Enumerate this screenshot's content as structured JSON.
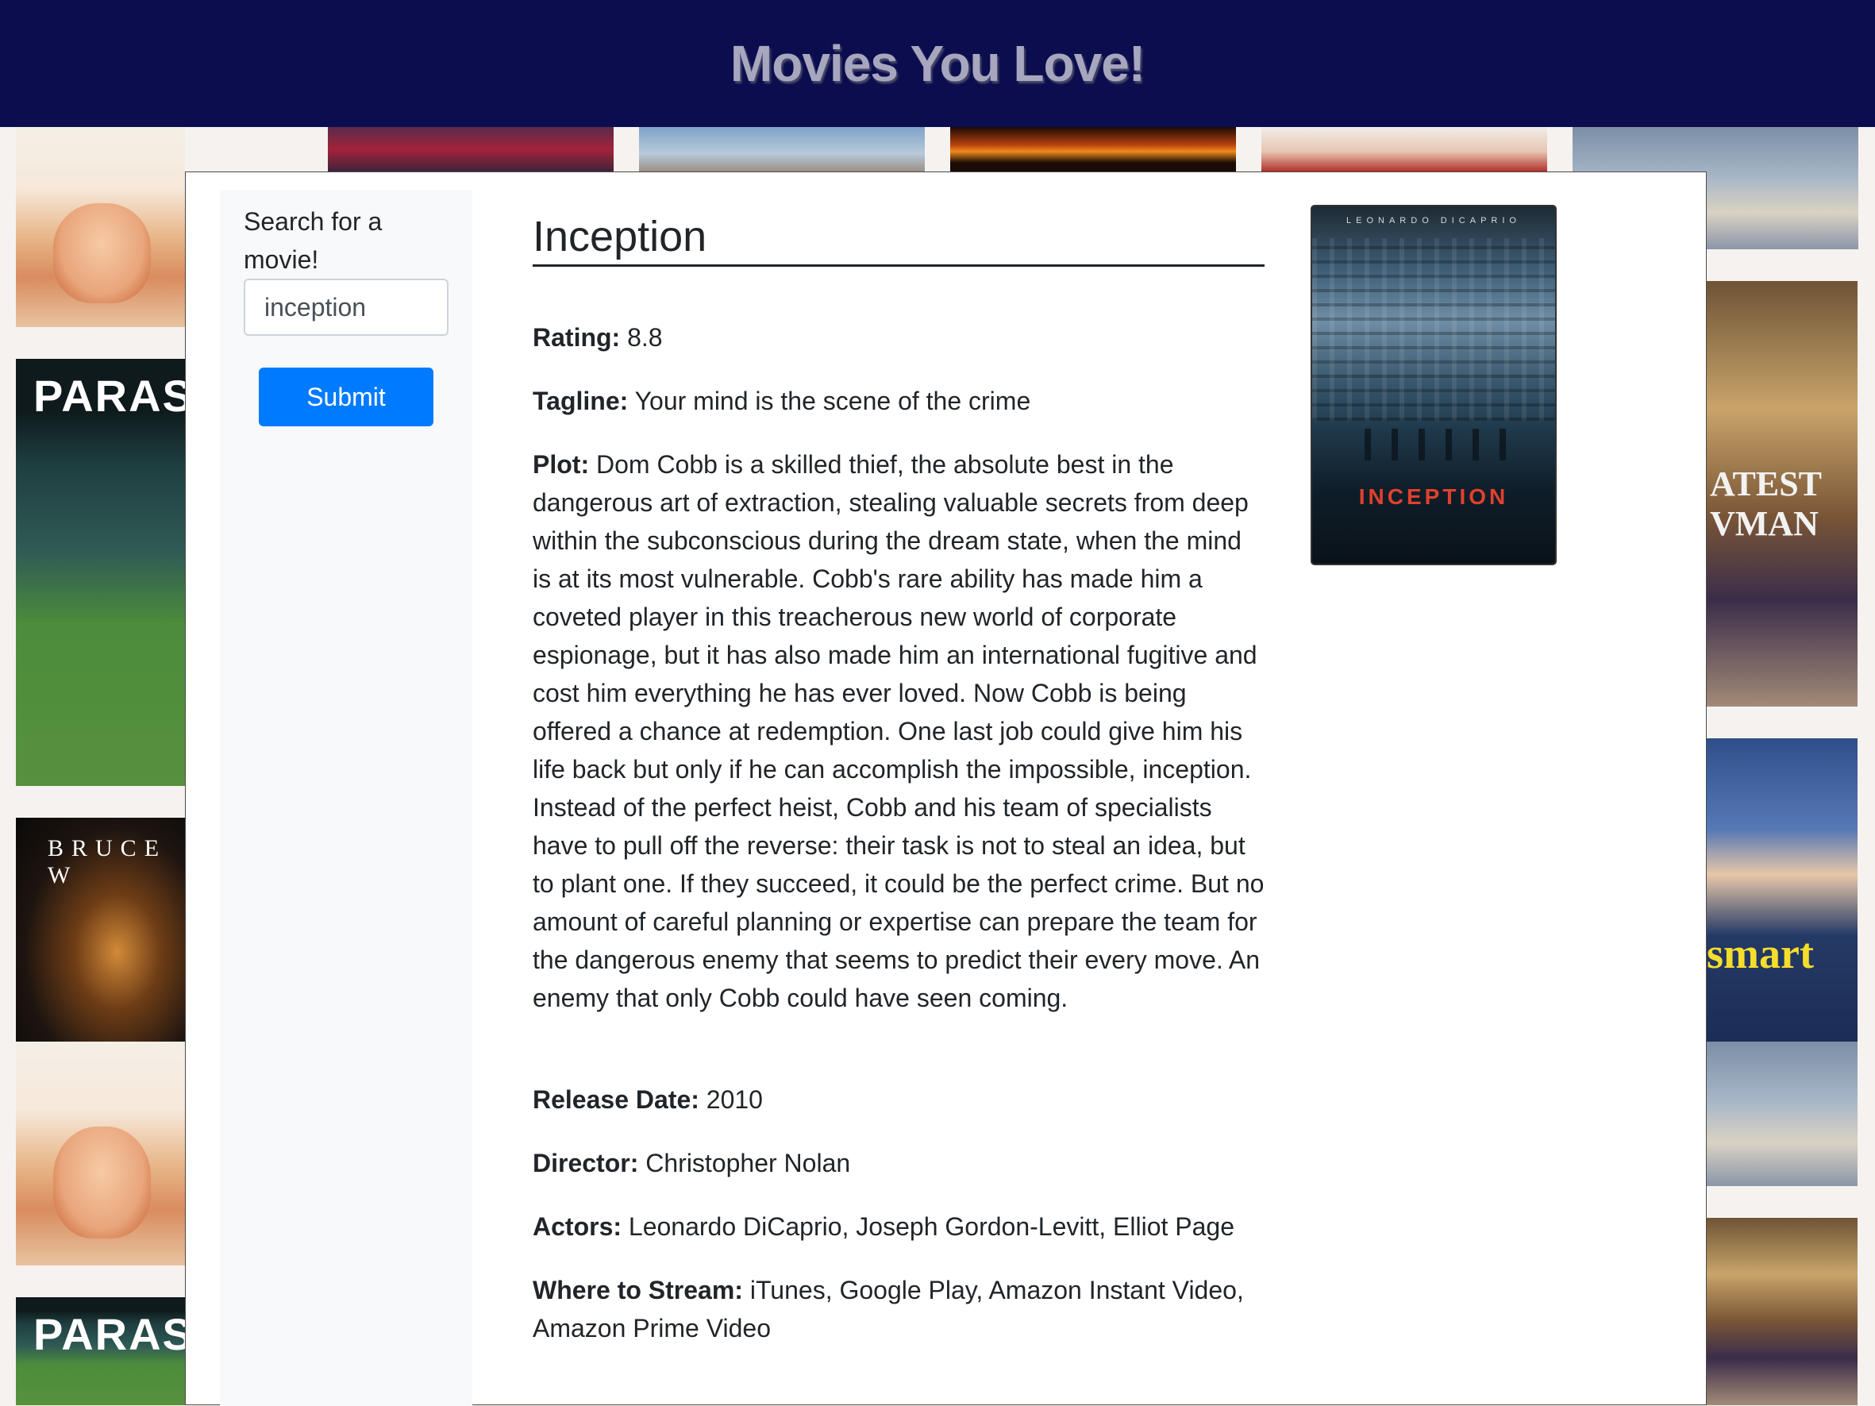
{
  "header": {
    "title": "Movies You Love!"
  },
  "search": {
    "label": "Search for a movie!",
    "value": "inception",
    "submit_label": "Submit"
  },
  "movie": {
    "title": "Inception",
    "rating_label": "Rating:",
    "rating": "8.8",
    "tagline_label": "Tagline:",
    "tagline": "Your mind is the scene of the crime",
    "plot_label": "Plot:",
    "plot": "Dom Cobb is a skilled thief, the absolute best in the dangerous art of extraction, stealing valuable secrets from deep within the subconscious during the dream state, when the mind is at its most vulnerable. Cobb's rare ability has made him a coveted player in this treacherous new world of corporate espionage, but it has also made him an international fugitive and cost him everything he has ever loved. Now Cobb is being offered a chance at redemption. One last job could give him his life back but only if he can accomplish the impossible, inception. Instead of the perfect heist, Cobb and his team of specialists have to pull off the reverse: their task is not to steal an idea, but to plant one. If they succeed, it could be the perfect crime. But no amount of careful planning or expertise can prepare the team for the dangerous enemy that seems to predict their every move. An enemy that only Cobb could have seen coming.",
    "release_label": "Release Date:",
    "release": "2010",
    "director_label": "Director:",
    "director": "Christopher Nolan",
    "actors_label": "Actors:",
    "actors": "Leonardo DiCaprio, Joseph Gordon-Levitt, Elliot Page",
    "stream_label": "Where to Stream:",
    "stream": "iTunes, Google Play, Amazon Instant Video, Amazon Prime Video",
    "poster": {
      "top_text": "LEONARDO DICAPRIO",
      "title_text": "INCEPTION"
    }
  },
  "background": {
    "tile_parasite": "PARAS",
    "tile_bruce": "BRUCE W",
    "tile_greatest_1": "ATEST",
    "tile_greatest_2": "VMAN",
    "tile_booksmart": "smart"
  },
  "colors": {
    "header_bg": "#0b0d4f",
    "header_text": "#a7a6bf",
    "button_bg": "#007bff",
    "sidebar_bg": "#f8f9fa"
  }
}
